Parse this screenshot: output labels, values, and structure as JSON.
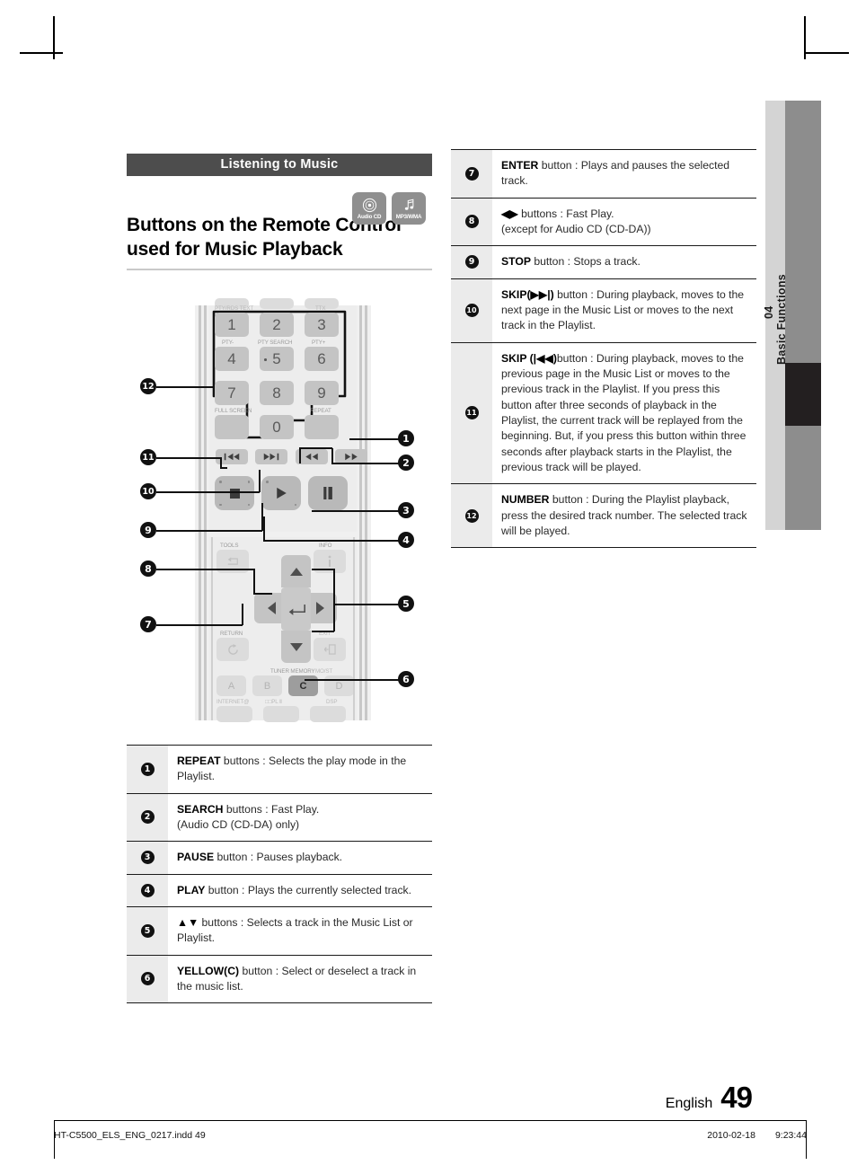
{
  "sidebar": {
    "chapter_number": "04",
    "chapter_title": "Basic Functions"
  },
  "section": {
    "bar_label": "Listening to Music"
  },
  "media_badges": [
    {
      "icon": "audio-cd-icon",
      "label": "Audio CD"
    },
    {
      "icon": "music-note-icon",
      "label": "MP3/WMA"
    }
  ],
  "page_title": "Buttons on the Remote Control used for Music Playback",
  "remote": {
    "numeric_keys": [
      "1",
      "2",
      "3",
      "4",
      "5",
      "6",
      "7",
      "8",
      "9",
      "0"
    ],
    "key_labels": {
      "pty_minus": "PTY-",
      "pty_search": "PTY SEARCH",
      "pty_plus": "PTY+",
      "full_screen": "FULL SCREEN",
      "repeat": "REPEAT",
      "tools": "TOOLS",
      "info": "INFO",
      "return": "RETURN",
      "exit": "EXIT",
      "tuner_memory": "TUNER MEMORY",
      "mo_st": "MO/ST",
      "internet": "INTERNET@",
      "dolby": "PL",
      "dsp": "DSP"
    },
    "color_keys": [
      "A",
      "B",
      "C",
      "D"
    ],
    "callouts_left": [
      "12",
      "11",
      "10",
      "9",
      "8",
      "7"
    ],
    "callouts_right": [
      "1",
      "2",
      "3",
      "4",
      "5",
      "6"
    ]
  },
  "table_left": [
    {
      "n": "1",
      "bold": "REPEAT",
      "text": " buttons : Selects the play mode in the Playlist."
    },
    {
      "n": "2",
      "bold": "SEARCH",
      "text": " buttons : Fast Play.",
      "line2": "(Audio CD (CD-DA) only)"
    },
    {
      "n": "3",
      "bold": "PAUSE",
      "text": " button : Pauses playback."
    },
    {
      "n": "4",
      "bold": "PLAY",
      "text": " button : Plays the currently selected track."
    },
    {
      "n": "5",
      "bold": "▲▼",
      "text": " buttons : Selects a track in the Music List or Playlist."
    },
    {
      "n": "6",
      "bold": "YELLOW(C)",
      "text": " button : Select or deselect a track in the music list."
    }
  ],
  "table_right": [
    {
      "n": "7",
      "bold": "ENTER",
      "text": " button : Plays and pauses the selected track."
    },
    {
      "n": "8",
      "bold": "◀▶",
      "text": " buttons : Fast Play.",
      "line2": "(except for Audio CD (CD-DA))"
    },
    {
      "n": "9",
      "bold": "STOP",
      "text": " button : Stops a track."
    },
    {
      "n": "10",
      "bold": "SKIP(▶▶|)",
      "text": " button : During playback, moves to the next page in the Music List or moves to the next track in the Playlist."
    },
    {
      "n": "11",
      "bold": "SKIP (|◀◀)",
      "text": "button : During playback, moves to the previous page in the Music List or moves to the previous track in the Playlist. If you press this button after three seconds of playback in the Playlist, the current track will be replayed from the beginning. But, if you press this button within three seconds after playback starts in the Playlist, the previous track will be played."
    },
    {
      "n": "12",
      "bold": "NUMBER",
      "text": " button : During the Playlist playback, press the desired track number. The selected track will be played."
    }
  ],
  "footer": {
    "language": "English",
    "page_number": "49"
  },
  "print_footer": {
    "file_name": "HT-C5500_ELS_ENG_0217.indd   49",
    "date": "2010-02-18",
    "time": "9:23:44"
  },
  "colors": {
    "bar": "#4d4d4d",
    "sidebar_dark": "#8d8d8d",
    "sidebar_light": "#d4d4d4",
    "accent_black": "#231f20"
  }
}
